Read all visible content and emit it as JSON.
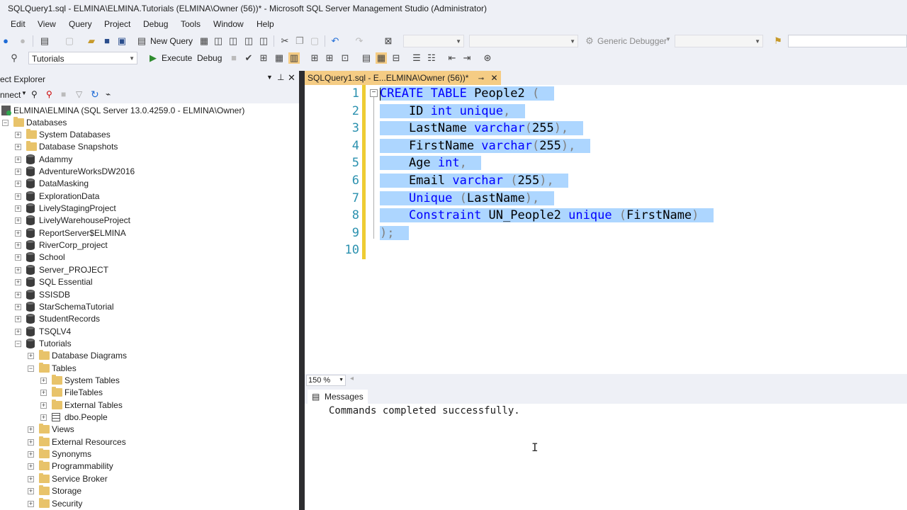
{
  "window": {
    "title": "SQLQuery1.sql - ELMINA\\ELMINA.Tutorials (ELMINA\\Owner (56))* - Microsoft SQL Server Management Studio (Administrator)"
  },
  "menu": [
    "Edit",
    "View",
    "Query",
    "Project",
    "Debug",
    "Tools",
    "Window",
    "Help"
  ],
  "toolbar1": {
    "new_query_label": "New Query",
    "debugger_combo": "Generic Debugger"
  },
  "toolbar2": {
    "database_combo": "Tutorials",
    "execute_label": "Execute",
    "debug_label": "Debug"
  },
  "object_explorer": {
    "title": "ect Explorer",
    "connect_label": "nnect",
    "server": "ELMINA\\ELMINA (SQL Server 13.0.4259.0 - ELMINA\\Owner)",
    "databases_label": "Databases",
    "nodes": [
      {
        "label": "System Databases",
        "icon": "folder"
      },
      {
        "label": "Database Snapshots",
        "icon": "folder"
      },
      {
        "label": "Adammy",
        "icon": "db"
      },
      {
        "label": "AdventureWorksDW2016",
        "icon": "db"
      },
      {
        "label": "DataMasking",
        "icon": "db"
      },
      {
        "label": "ExplorationData",
        "icon": "db"
      },
      {
        "label": "LivelyStagingProject",
        "icon": "db"
      },
      {
        "label": "LivelyWarehouseProject",
        "icon": "db"
      },
      {
        "label": "ReportServer$ELMINA",
        "icon": "db"
      },
      {
        "label": "RiverCorp_project",
        "icon": "db"
      },
      {
        "label": "School",
        "icon": "db"
      },
      {
        "label": "Server_PROJECT",
        "icon": "db"
      },
      {
        "label": "SQL Essential",
        "icon": "db"
      },
      {
        "label": "SSISDB",
        "icon": "db"
      },
      {
        "label": "StarSchemaTutorial",
        "icon": "db"
      },
      {
        "label": "StudentRecords",
        "icon": "db"
      },
      {
        "label": "TSQLV4",
        "icon": "db"
      },
      {
        "label": "Tutorials",
        "icon": "db"
      }
    ],
    "tutorials_children": [
      {
        "label": "Database Diagrams",
        "icon": "folder"
      },
      {
        "label": "Tables",
        "icon": "folder"
      }
    ],
    "tables_children": [
      {
        "label": "System Tables",
        "icon": "folder"
      },
      {
        "label": "FileTables",
        "icon": "folder"
      },
      {
        "label": "External Tables",
        "icon": "folder"
      },
      {
        "label": "dbo.People",
        "icon": "table"
      }
    ],
    "tutorials_more": [
      {
        "label": "Views",
        "icon": "folder"
      },
      {
        "label": "External Resources",
        "icon": "folder"
      },
      {
        "label": "Synonyms",
        "icon": "folder"
      },
      {
        "label": "Programmability",
        "icon": "folder"
      },
      {
        "label": "Service Broker",
        "icon": "folder"
      },
      {
        "label": "Storage",
        "icon": "folder"
      },
      {
        "label": "Security",
        "icon": "folder"
      }
    ]
  },
  "editor": {
    "tab_label": "SQLQuery1.sql - E...ELMINA\\Owner (56))*",
    "line_numbers": [
      "1",
      "2",
      "3",
      "4",
      "5",
      "6",
      "7",
      "8",
      "9",
      "10"
    ],
    "zoom": "150 %",
    "code": [
      [
        {
          "t": "CREATE TABLE",
          "c": "kw"
        },
        {
          "t": " People2 ",
          "c": "df"
        },
        {
          "t": "(",
          "c": "gr"
        }
      ],
      [
        {
          "t": "    ID ",
          "c": "df"
        },
        {
          "t": "int unique",
          "c": "kw"
        },
        {
          "t": ",",
          "c": "gr"
        }
      ],
      [
        {
          "t": "    LastName ",
          "c": "df"
        },
        {
          "t": "varchar",
          "c": "kw"
        },
        {
          "t": "(",
          "c": "gr"
        },
        {
          "t": "255",
          "c": "df"
        },
        {
          "t": "),",
          "c": "gr"
        }
      ],
      [
        {
          "t": "    FirstName ",
          "c": "df"
        },
        {
          "t": "varchar",
          "c": "kw"
        },
        {
          "t": "(",
          "c": "gr"
        },
        {
          "t": "255",
          "c": "df"
        },
        {
          "t": "),",
          "c": "gr"
        }
      ],
      [
        {
          "t": "    Age ",
          "c": "df"
        },
        {
          "t": "int",
          "c": "kw"
        },
        {
          "t": ",",
          "c": "gr"
        }
      ],
      [
        {
          "t": "    Email ",
          "c": "df"
        },
        {
          "t": "varchar",
          "c": "kw"
        },
        {
          "t": " (",
          "c": "gr"
        },
        {
          "t": "255",
          "c": "df"
        },
        {
          "t": "),",
          "c": "gr"
        }
      ],
      [
        {
          "t": "    ",
          "c": "df"
        },
        {
          "t": "Unique",
          "c": "kw"
        },
        {
          "t": " (",
          "c": "gr"
        },
        {
          "t": "LastName",
          "c": "df"
        },
        {
          "t": "),",
          "c": "gr"
        }
      ],
      [
        {
          "t": "    ",
          "c": "df"
        },
        {
          "t": "Constraint",
          "c": "kw"
        },
        {
          "t": " UN_People2 ",
          "c": "df"
        },
        {
          "t": "unique",
          "c": "kw"
        },
        {
          "t": " (",
          "c": "gr"
        },
        {
          "t": "FirstName",
          "c": "df"
        },
        {
          "t": ")",
          "c": "gr"
        }
      ],
      [
        {
          "t": ");",
          "c": "gr"
        }
      ],
      []
    ]
  },
  "messages": {
    "tab_label": "Messages",
    "text": "Commands completed successfully."
  },
  "colors": {
    "accent_tab": "#f5cc84",
    "selection": "#add6ff",
    "keyword": "#0000ff",
    "line_number": "#2b91af"
  }
}
